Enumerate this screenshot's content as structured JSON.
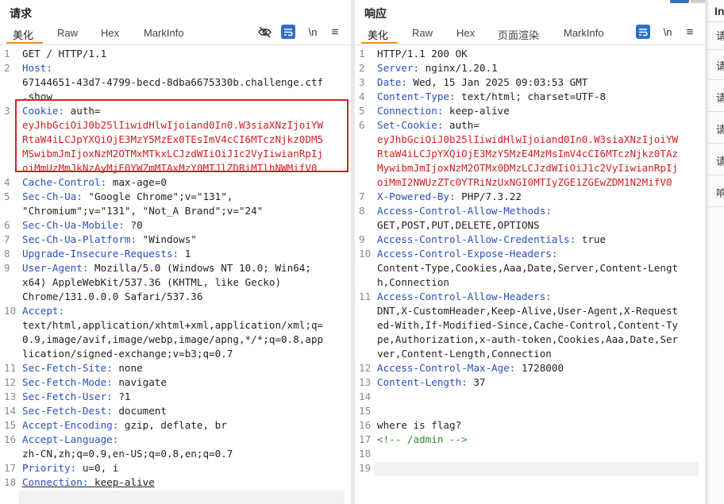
{
  "request": {
    "title": "请求",
    "tabs": [
      "美化",
      "Raw",
      "Hex",
      "MarkInfo"
    ],
    "active_tab": 0,
    "tools": {
      "hide": "eye-off-icon",
      "wrap": "wrap-icon",
      "newline": "\\n",
      "menu": "≡"
    },
    "lines": [
      {
        "n": "1",
        "k": "",
        "v": "GET / HTTP/1.1"
      },
      {
        "n": "2",
        "k": "Host:",
        "v": ""
      },
      {
        "n": "",
        "k": "",
        "v": "67144651-43d7-4799-becd-8dba6675330b.challenge.ctf"
      },
      {
        "n": "",
        "k": "",
        "v": ".show"
      },
      {
        "n": "3",
        "k": "Cookie:",
        "v": " auth=",
        "red": false
      },
      {
        "n": "",
        "k": "",
        "v": "eyJhbGciOiJ0b25lIiwidHlwIjoiand0In0.W3siaXNzIjoiYW",
        "red": true
      },
      {
        "n": "",
        "k": "",
        "v": "RtaW4iLCJpYXQiOjE3MzY5MzEx0TEsImV4cCI6MTczNjkz0DM5",
        "red": true
      },
      {
        "n": "",
        "k": "",
        "v": "MSwibmJmIjoxNzM2OTMxMTkxLCJzdWIiOiJ1c2VyIiwianRpIj",
        "red": true
      },
      {
        "n": "",
        "k": "",
        "v": "oiMmUzMmJkNzAyMjE0YWZmMTAxMzY0MTJlZDRiMTlhNWMifV0",
        "red": true
      },
      {
        "n": "4",
        "k": "Cache-Control:",
        "v": " max-age=0"
      },
      {
        "n": "5",
        "k": "Sec-Ch-Ua:",
        "v": " \"Google Chrome\";v=\"131\","
      },
      {
        "n": "",
        "k": "",
        "v": "\"Chromium\";v=\"131\", \"Not_A Brand\";v=\"24\""
      },
      {
        "n": "6",
        "k": "Sec-Ch-Ua-Mobile:",
        "v": " ?0"
      },
      {
        "n": "7",
        "k": "Sec-Ch-Ua-Platform:",
        "v": " \"Windows\""
      },
      {
        "n": "8",
        "k": "Upgrade-Insecure-Requests:",
        "v": " 1"
      },
      {
        "n": "9",
        "k": "User-Agent:",
        "v": " Mozilla/5.0 (Windows NT 10.0; Win64;"
      },
      {
        "n": "",
        "k": "",
        "v": "x64) AppleWebKit/537.36 (KHTML, like Gecko)"
      },
      {
        "n": "",
        "k": "",
        "v": "Chrome/131.0.0.0 Safari/537.36"
      },
      {
        "n": "10",
        "k": "Accept:",
        "v": ""
      },
      {
        "n": "",
        "k": "",
        "v": "text/html,application/xhtml+xml,application/xml;q="
      },
      {
        "n": "",
        "k": "",
        "v": "0.9,image/avif,image/webp,image/apng,*/*;q=0.8,app"
      },
      {
        "n": "",
        "k": "",
        "v": "lication/signed-exchange;v=b3;q=0.7"
      },
      {
        "n": "11",
        "k": "Sec-Fetch-Site:",
        "v": " none"
      },
      {
        "n": "12",
        "k": "Sec-Fetch-Mode:",
        "v": " navigate"
      },
      {
        "n": "13",
        "k": "Sec-Fetch-User:",
        "v": " ?1"
      },
      {
        "n": "14",
        "k": "Sec-Fetch-Dest:",
        "v": " document"
      },
      {
        "n": "15",
        "k": "Accept-Encoding:",
        "v": " gzip, deflate, br"
      },
      {
        "n": "16",
        "k": "Accept-Language:",
        "v": ""
      },
      {
        "n": "",
        "k": "",
        "v": "zh-CN,zh;q=0.9,en-US;q=0.8,en;q=0.7"
      },
      {
        "n": "17",
        "k": "Priority:",
        "v": " u=0, i"
      },
      {
        "n": "18",
        "k": "Connection:",
        "v": " keep-alive"
      }
    ]
  },
  "response": {
    "title": "响应",
    "tabs": [
      "美化",
      "Raw",
      "Hex",
      "页面渲染",
      "MarkInfo"
    ],
    "active_tab": 0,
    "tools": {
      "wrap": "wrap-icon",
      "newline": "\\n",
      "menu": "≡"
    },
    "lines": [
      {
        "n": "1",
        "k": "",
        "v": "HTTP/1.1 200 OK"
      },
      {
        "n": "2",
        "k": "Server:",
        "v": " nginx/1.20.1"
      },
      {
        "n": "3",
        "k": "Date:",
        "v": " Wed, 15 Jan 2025 09:03:53 GMT"
      },
      {
        "n": "4",
        "k": "Content-Type:",
        "v": " text/html; charset=UTF-8"
      },
      {
        "n": "5",
        "k": "Connection:",
        "v": " keep-alive"
      },
      {
        "n": "6",
        "k": "Set-Cookie:",
        "v": " auth="
      },
      {
        "n": "",
        "k": "",
        "v": "eyJhbGciOiJ0b25lIiwidHlwIjoiand0In0.W3siaXNzIjoiYW",
        "red": true
      },
      {
        "n": "",
        "k": "",
        "v": "RtaW4iLCJpYXQiOjE3MzY5MzE4MzMsImV4cCI6MTczNjkz0TAz",
        "red": true
      },
      {
        "n": "",
        "k": "",
        "v": "MywibmJmIjoxNzM2OTMx0DMzLCJzdWIiOiJ1c2VyIiwianRpIj",
        "red": true
      },
      {
        "n": "",
        "k": "",
        "v": "oiMmI2NWUzZTc0YTRiNzUxNGI0MTIyZGE1ZGEwZDM1N2MifV0",
        "red": true
      },
      {
        "n": "7",
        "k": "X-Powered-By:",
        "v": " PHP/7.3.22"
      },
      {
        "n": "8",
        "k": "Access-Control-Allow-Methods:",
        "v": ""
      },
      {
        "n": "",
        "k": "",
        "v": "GET,POST,PUT,DELETE,OPTIONS"
      },
      {
        "n": "9",
        "k": "Access-Control-Allow-Credentials:",
        "v": " true"
      },
      {
        "n": "10",
        "k": "Access-Control-Expose-Headers:",
        "v": ""
      },
      {
        "n": "",
        "k": "",
        "v": "Content-Type,Cookies,Aaa,Date,Server,Content-Lengt"
      },
      {
        "n": "",
        "k": "",
        "v": "h,Connection"
      },
      {
        "n": "11",
        "k": "Access-Control-Allow-Headers:",
        "v": ""
      },
      {
        "n": "",
        "k": "",
        "v": "DNT,X-CustomHeader,Keep-Alive,User-Agent,X-Request"
      },
      {
        "n": "",
        "k": "",
        "v": "ed-With,If-Modified-Since,Cache-Control,Content-Ty"
      },
      {
        "n": "",
        "k": "",
        "v": "pe,Authorization,x-auth-token,Cookies,Aaa,Date,Ser"
      },
      {
        "n": "",
        "k": "",
        "v": "ver,Content-Length,Connection"
      },
      {
        "n": "12",
        "k": "Access-Control-Max-Age:",
        "v": " 1728000"
      },
      {
        "n": "13",
        "k": "Content-Length:",
        "v": " 37"
      },
      {
        "n": "14",
        "k": "",
        "v": ""
      },
      {
        "n": "15",
        "k": "",
        "v": ""
      },
      {
        "n": "16",
        "k": "",
        "v": "where is flag?"
      },
      {
        "n": "17",
        "k": "",
        "v": "<!-- /admin -->",
        "green": true
      },
      {
        "n": "18",
        "k": "",
        "v": ""
      },
      {
        "n": "19",
        "k": "",
        "v": ""
      }
    ]
  },
  "inspector": {
    "title": "In",
    "items": [
      "请",
      "请",
      "请",
      "请",
      "请",
      "响"
    ]
  },
  "colors": {
    "accent": "#f08a24",
    "header_key": "#2a4fbf",
    "cookie_value": "#d42020",
    "highlight_box": "#d82020",
    "comment": "#2e8b2e"
  }
}
